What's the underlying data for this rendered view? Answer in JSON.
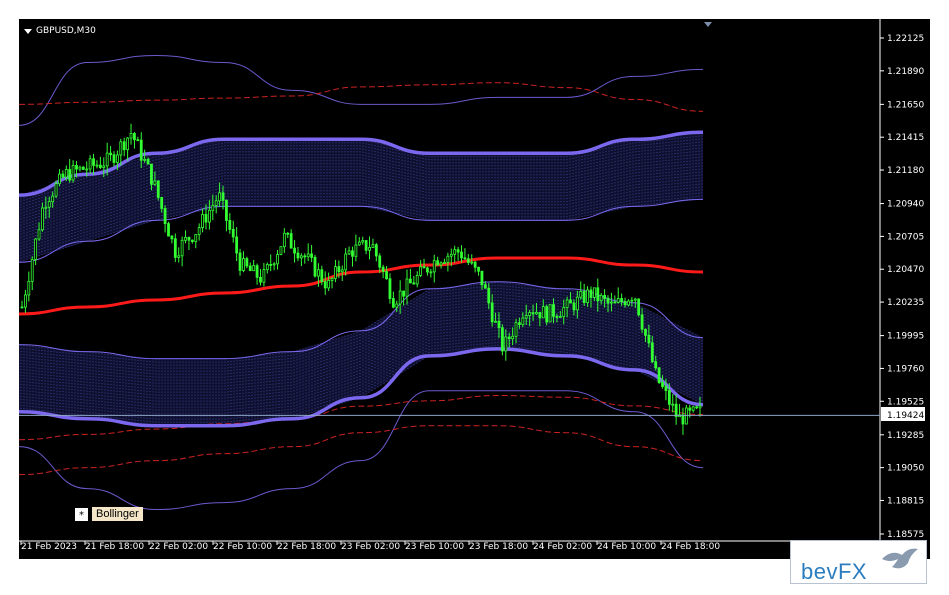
{
  "window": {
    "symbol_title": "GBPUSD,M30"
  },
  "current_price": "1.19424",
  "indicator": {
    "star": "*",
    "label": "Bollinger"
  },
  "logo": {
    "text": "bevFX",
    "color": "#2b7dbf"
  },
  "colors": {
    "background": "#000000",
    "candle": "#33ff33",
    "middle_band": "#ff1a1a",
    "inner_band": "#7b68ee",
    "outer_band": "#6a5acd",
    "dashed_band": "#cc2222",
    "price_line": "#8fa5c8"
  },
  "chart_data": {
    "type": "candlestick",
    "title": "GBPUSD,M30",
    "y_ticks": [
      "1.22125",
      "1.21890",
      "1.21650",
      "1.21415",
      "1.21180",
      "1.20940",
      "1.20705",
      "1.20470",
      "1.20235",
      "1.19995",
      "1.19760",
      "1.19525",
      "1.19285",
      "1.19050",
      "1.18815",
      "1.18575"
    ],
    "x_ticks": [
      "21 Feb 2023",
      "21 Feb 18:00",
      "22 Feb 02:00",
      "22 Feb 10:00",
      "22 Feb 18:00",
      "23 Feb 02:00",
      "23 Feb 10:00",
      "23 Feb 18:00",
      "24 Feb 02:00",
      "24 Feb 10:00",
      "24 Feb 18:00"
    ],
    "ylim": [
      1.18575,
      1.22125
    ],
    "last_price": 1.19424,
    "close_approx": [
      1.202,
      1.2095,
      1.2115,
      1.212,
      1.2125,
      1.2145,
      1.211,
      1.206,
      1.2075,
      1.21,
      1.205,
      1.204,
      1.207,
      1.2055,
      1.2035,
      1.206,
      1.2065,
      1.2025,
      1.204,
      1.2055,
      1.206,
      1.204,
      1.199,
      1.202,
      1.2015,
      1.202,
      1.203,
      1.202,
      1.203,
      1.197,
      1.194,
      1.1945
    ],
    "middle_band_approx": [
      1.2015,
      1.202,
      1.2025,
      1.203,
      1.2035,
      1.2045,
      1.205,
      1.2055,
      1.2055,
      1.205,
      1.2045
    ],
    "inner_upper_approx": [
      1.21,
      1.2115,
      1.213,
      1.214,
      1.214,
      1.214,
      1.213,
      1.213,
      1.213,
      1.214,
      1.2145
    ],
    "inner_lower_approx": [
      1.1945,
      1.194,
      1.1935,
      1.1935,
      1.194,
      1.1955,
      1.1985,
      1.199,
      1.1985,
      1.1975,
      1.195
    ],
    "outer_upper_approx": [
      1.215,
      1.2195,
      1.22,
      1.2195,
      1.2175,
      1.2165,
      1.2165,
      1.217,
      1.217,
      1.2185,
      1.219
    ],
    "outer_lower_approx": [
      1.192,
      1.189,
      1.1875,
      1.188,
      1.189,
      1.191,
      1.196,
      1.196,
      1.196,
      1.1945,
      1.1905
    ],
    "grid": false,
    "legend": "none"
  }
}
